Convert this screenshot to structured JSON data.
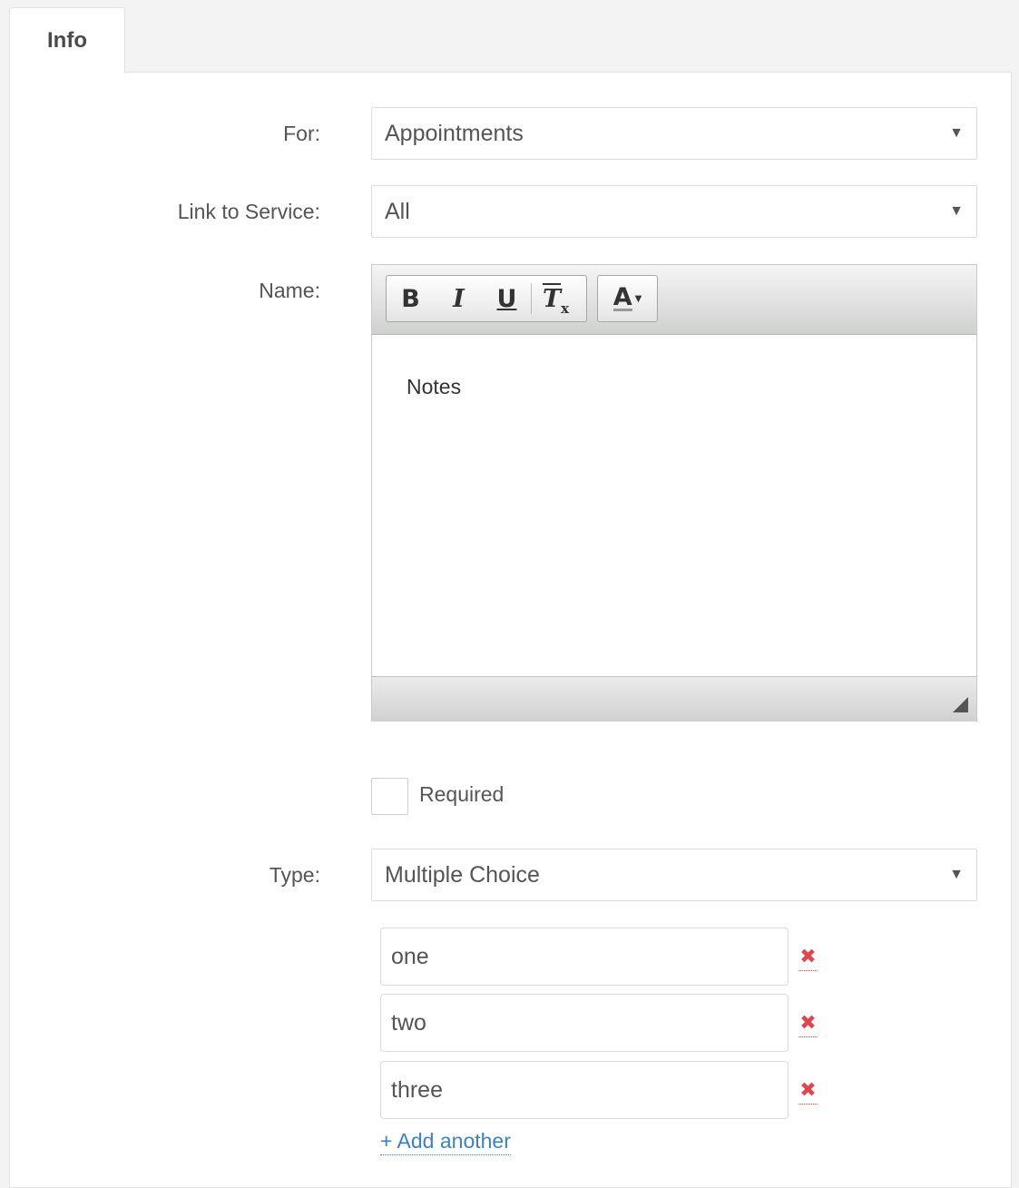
{
  "tab": {
    "label": "Info"
  },
  "form": {
    "for": {
      "label": "For:",
      "value": "Appointments"
    },
    "link_service": {
      "label": "Link to Service:",
      "value": "All"
    },
    "name": {
      "label": "Name:",
      "toolbar": {
        "bold": "B",
        "italic": "I",
        "underline": "U",
        "clear": "T",
        "clear_sub": "x",
        "color": "A"
      },
      "content": "Notes"
    },
    "required": {
      "label": "Required",
      "checked": false
    },
    "type": {
      "label": "Type:",
      "value": "Multiple Choice"
    },
    "options": [
      {
        "value": "one"
      },
      {
        "value": "two"
      },
      {
        "value": "three"
      }
    ],
    "remove_glyph": "✖",
    "add_another": "+ Add another"
  },
  "colors": {
    "link": "#3b82c4",
    "remove": "#e0474c"
  }
}
